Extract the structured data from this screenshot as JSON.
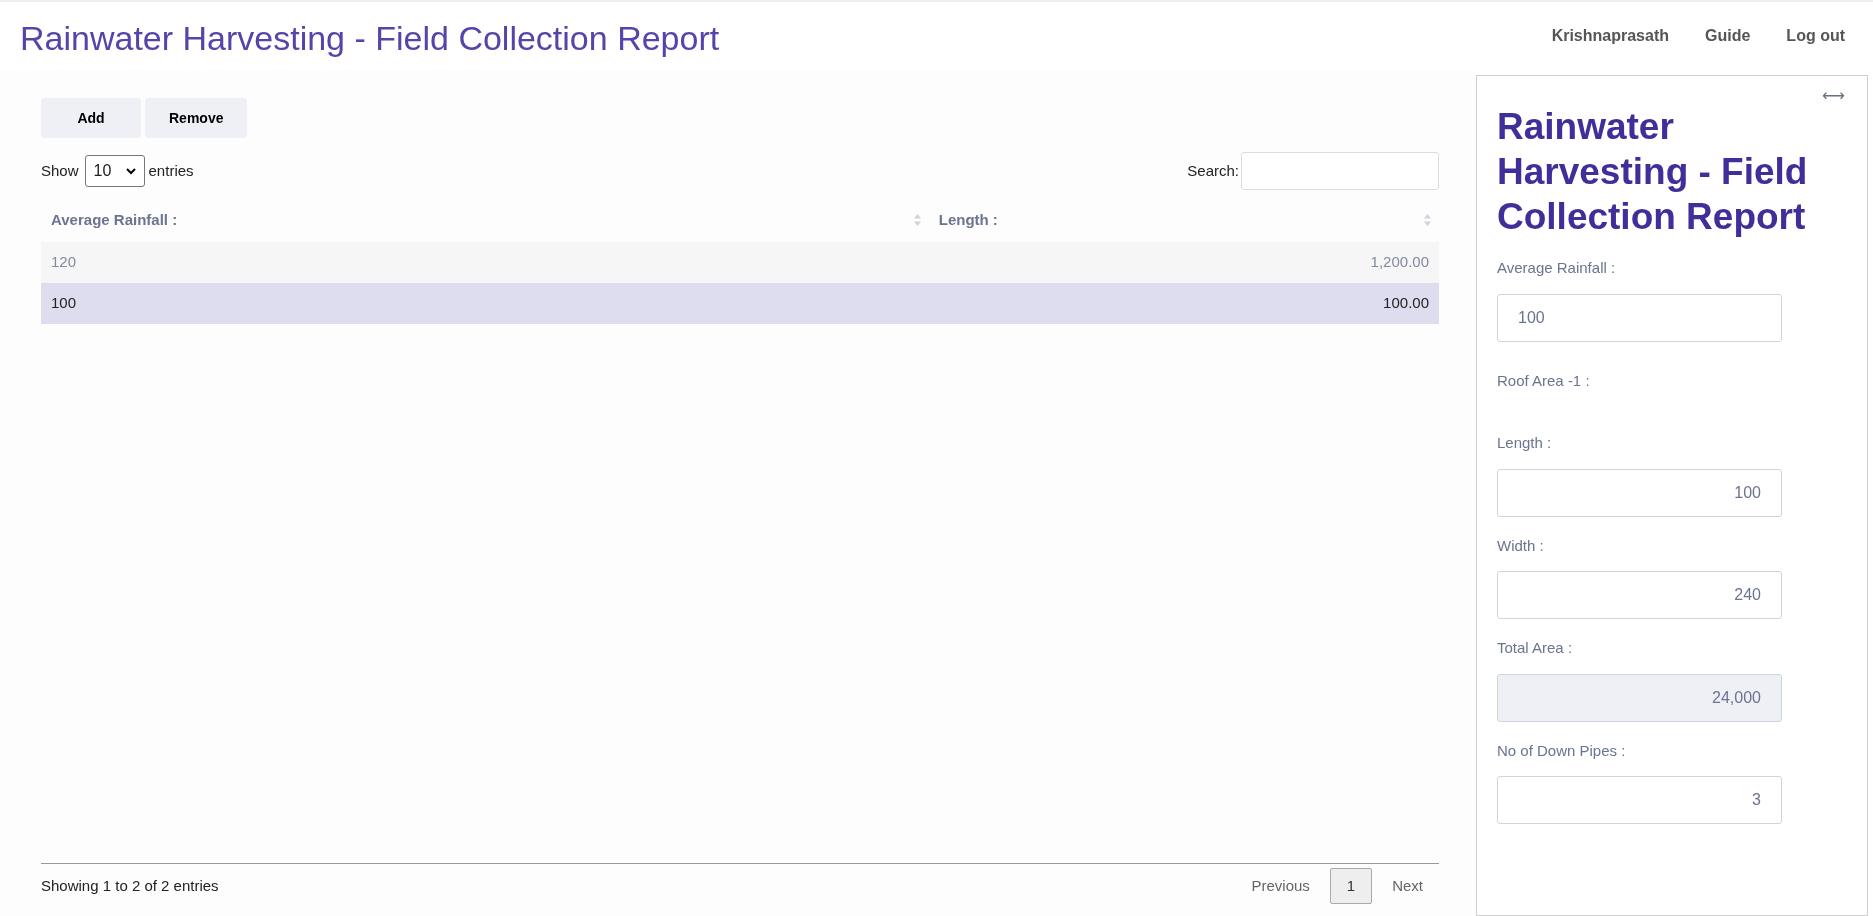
{
  "header": {
    "title": "Rainwater Harvesting - Field Collection Report",
    "nav": [
      "Krishnaprasath",
      "Guide",
      "Log out"
    ]
  },
  "toolbar": {
    "buttons": [
      "Add",
      "Remove"
    ]
  },
  "table_controls": {
    "show_label": "Show",
    "page_size": "10",
    "entries_label": "entries",
    "search_label": "Search:"
  },
  "table": {
    "columns": [
      "Average Rainfall :",
      "Length :"
    ],
    "rows": [
      {
        "cells": [
          "120",
          "1,200.00"
        ],
        "selected": false
      },
      {
        "cells": [
          "100",
          "100.00"
        ],
        "selected": true
      }
    ]
  },
  "footer": {
    "info": "Showing 1 to 2 of 2 entries",
    "pagination": [
      {
        "label": "Previous",
        "selected": false
      },
      {
        "label": "1",
        "selected": true
      },
      {
        "label": "Next",
        "selected": false
      }
    ]
  },
  "panel": {
    "resize_glyph": "⟷",
    "title": "Rainwater Harvesting - Field Collection Report",
    "fields": [
      {
        "kind": "text",
        "label": "Average Rainfall :",
        "value": "100",
        "disabled": false
      },
      {
        "kind": "heading",
        "label": "Roof Area -1 :"
      },
      {
        "kind": "number",
        "label": "Length :",
        "value": "100",
        "disabled": false
      },
      {
        "kind": "number",
        "label": "Width :",
        "value": "240",
        "disabled": false
      },
      {
        "kind": "number",
        "label": "Total Area :",
        "value": "24,000",
        "disabled": true
      },
      {
        "kind": "number",
        "label": "No of Down Pipes :",
        "value": "3",
        "disabled": false
      }
    ]
  }
}
